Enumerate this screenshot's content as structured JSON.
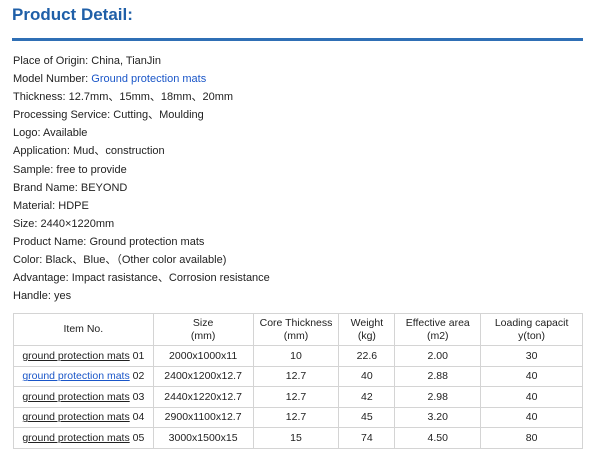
{
  "header": {
    "title": "Product Detail:"
  },
  "specs": [
    {
      "label": "Place of Origin:",
      "value": "China, TianJin"
    },
    {
      "label": "Model Number:",
      "value": "Ground protection mats",
      "link": true
    },
    {
      "label": "Thickness:",
      "value": "12.7mm、15mm、18mm、20mm"
    },
    {
      "label": "Processing Service:",
      "value": "Cutting、Moulding"
    },
    {
      "label": "Logo:",
      "value": "Available"
    },
    {
      "label": "Application:",
      "value": "Mud、construction"
    },
    {
      "label": "Sample:",
      "value": "free to provide"
    },
    {
      "label": "Brand Name:",
      "value": "BEYOND"
    },
    {
      "label": "Material:",
      "value": "HDPE"
    },
    {
      "label": "Size:",
      "value": "2440×1220mm"
    },
    {
      "label": "Product Name:",
      "value": "Ground protection mats"
    },
    {
      "label": "Color:",
      "value": "Black、Blue、（Other color available)"
    },
    {
      "label": "Advantage:",
      "value": "Impact rasistance、Corrosion resistance"
    },
    {
      "label": "Handle:",
      "value": "yes"
    }
  ],
  "table": {
    "headers": [
      {
        "line1": "Item No.",
        "line2": ""
      },
      {
        "line1": "Size",
        "line2": "(mm)"
      },
      {
        "line1": "Core Thickness",
        "line2": "(mm)"
      },
      {
        "line1": "Weight",
        "line2": "(kg)"
      },
      {
        "line1": "Effective area",
        "line2": "(m2)"
      },
      {
        "line1": "Loading capacit",
        "line2": "y(ton)"
      }
    ],
    "rows": [
      {
        "link_text": "ground protection mats",
        "suffix": " 01",
        "size": "2000x1000x11",
        "core": "10",
        "weight": "22.6",
        "area": "2.00",
        "load": "30",
        "active": false
      },
      {
        "link_text": "ground protection mats",
        "suffix": " 02",
        "size": "2400x1200x12.7",
        "core": "12.7",
        "weight": "40",
        "area": "2.88",
        "load": "40",
        "active": true
      },
      {
        "link_text": "ground protection mats",
        "suffix": " 03",
        "size": "2440x1220x12.7",
        "core": "12.7",
        "weight": "42",
        "area": "2.98",
        "load": "40",
        "active": false
      },
      {
        "link_text": "ground protection mats",
        "suffix": " 04",
        "size": "2900x1100x12.7",
        "core": "12.7",
        "weight": "45",
        "area": "3.20",
        "load": "40",
        "active": false
      },
      {
        "link_text": "ground protection mats",
        "suffix": " 05",
        "size": "3000x1500x15",
        "core": "15",
        "weight": "74",
        "area": "4.50",
        "load": "80",
        "active": false
      }
    ]
  },
  "colors": {
    "heading": "#1f5fa8",
    "rule": "#2f6fb5",
    "link": "#1a56c8"
  }
}
